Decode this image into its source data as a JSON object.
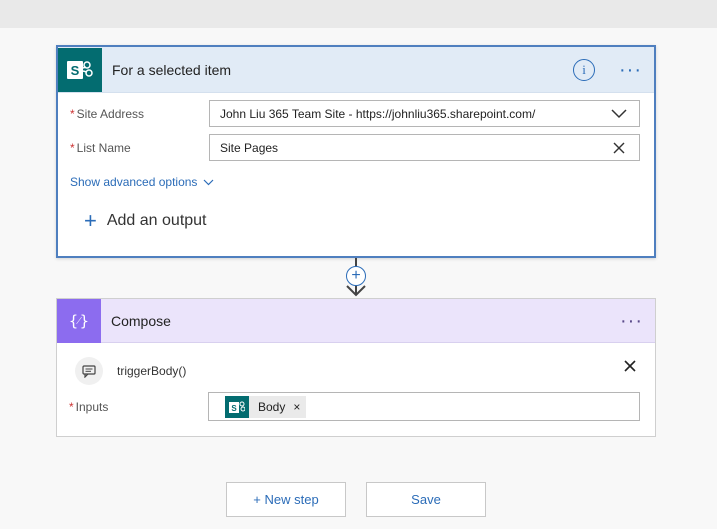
{
  "colors": {
    "accent": "#2b6cb8",
    "sharepoint_brand": "#036c70",
    "compose_brand": "#8c6cef",
    "trigger_header_bg": "#e1ebf6",
    "compose_header_bg": "#ebe4fb",
    "required": "#cc3333"
  },
  "trigger": {
    "icon": "sharepoint-icon",
    "title": "For a selected item",
    "info_icon": "info-icon",
    "more_icon": "more-options-icon",
    "fields": [
      {
        "label": "Site Address",
        "required": "*",
        "value": "John Liu 365 Team Site - https://johnliu365.sharepoint.com/",
        "trailing_icon": "chevron-down-icon"
      },
      {
        "label": "List Name",
        "required": "*",
        "value": "Site Pages",
        "trailing_icon": "clear-icon"
      }
    ],
    "advanced_label": "Show advanced options",
    "add_output_label": "Add an output"
  },
  "connector": {
    "insert_icon": "plus-circle-icon",
    "arrow_icon": "arrow-down-icon"
  },
  "compose": {
    "icon": "compose-icon",
    "title": "Compose",
    "more_icon": "more-options-icon",
    "token_text": "triggerBody()",
    "token_icon": "comment-icon",
    "close_icon": "close-icon",
    "inputs_label": "Inputs",
    "inputs_required": "*",
    "chip": {
      "icon": "sharepoint-icon",
      "label": "Body",
      "remove": "×"
    }
  },
  "buttons": {
    "new_step": "+ New step",
    "save": "Save"
  }
}
